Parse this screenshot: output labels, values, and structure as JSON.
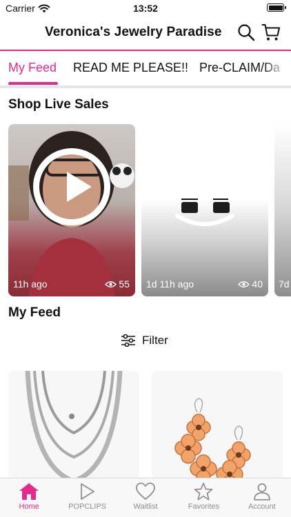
{
  "status_bar": {
    "carrier": "Carrier",
    "time": "13:52"
  },
  "header": {
    "title": "Veronica's Jewelry Paradise",
    "search_icon": "search-icon",
    "cart_icon": "cart-icon"
  },
  "tabs": [
    {
      "label": "My Feed",
      "active": true
    },
    {
      "label": "READ ME PLEASE!!",
      "active": false
    },
    {
      "label": "Pre-CLAIM/Da",
      "active": false
    }
  ],
  "live_sales": {
    "title": "Shop Live Sales",
    "cards": [
      {
        "age": "11h ago",
        "views": "55"
      },
      {
        "age": "1d 11h ago",
        "views": "40"
      },
      {
        "age": "7d"
      }
    ]
  },
  "feed": {
    "title": "My Feed",
    "filter_label": "Filter"
  },
  "bottom_nav": [
    {
      "label": "Home",
      "icon": "home-icon",
      "active": true
    },
    {
      "label": "POPCLIPS",
      "icon": "play-icon",
      "active": false
    },
    {
      "label": "Waitlist",
      "icon": "heart-icon",
      "active": false
    },
    {
      "label": "Favorites",
      "icon": "star-icon",
      "active": false
    },
    {
      "label": "Account",
      "icon": "person-icon",
      "active": false
    }
  ],
  "colors": {
    "accent": "#e62a8c",
    "inactive": "#8e8e8e"
  }
}
